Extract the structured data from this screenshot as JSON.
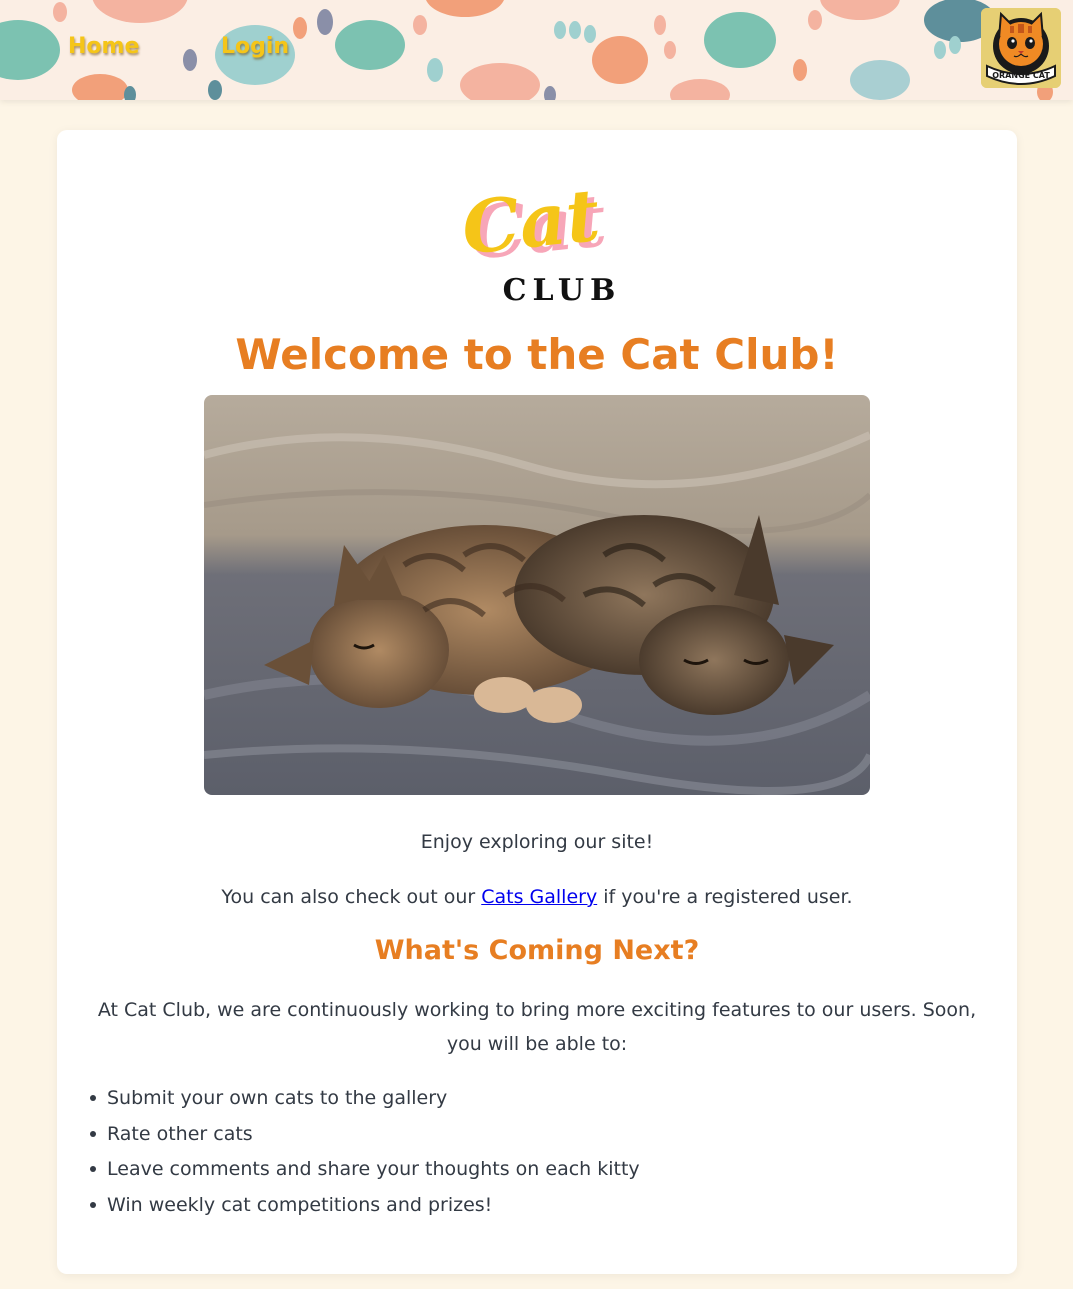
{
  "nav": {
    "home_label": "Home",
    "login_label": "Login",
    "badge_text": "ORANGE CAT"
  },
  "logo": {
    "line1": "Cat",
    "line2": "CLUB"
  },
  "main": {
    "title": "Welcome to the Cat Club!",
    "intro": "Enjoy exploring our site!",
    "gallery_prefix": "You can also check out our ",
    "gallery_link": "Cats Gallery",
    "gallery_suffix": " if you're a registered user.",
    "coming_title": "What's Coming Next?",
    "coming_text": "At Cat Club, we are continuously working to bring more exciting features to our users. Soon, you will be able to:",
    "features": [
      "Submit your own cats to the gallery",
      "Rate other cats",
      "Leave comments and share your thoughts on each kitty",
      "Win weekly cat competitions and prizes!"
    ]
  },
  "colors": {
    "accent": "#e77e22",
    "nav_text": "#f5c518",
    "page_bg": "#fdf5e6",
    "link": "#0000ee"
  }
}
